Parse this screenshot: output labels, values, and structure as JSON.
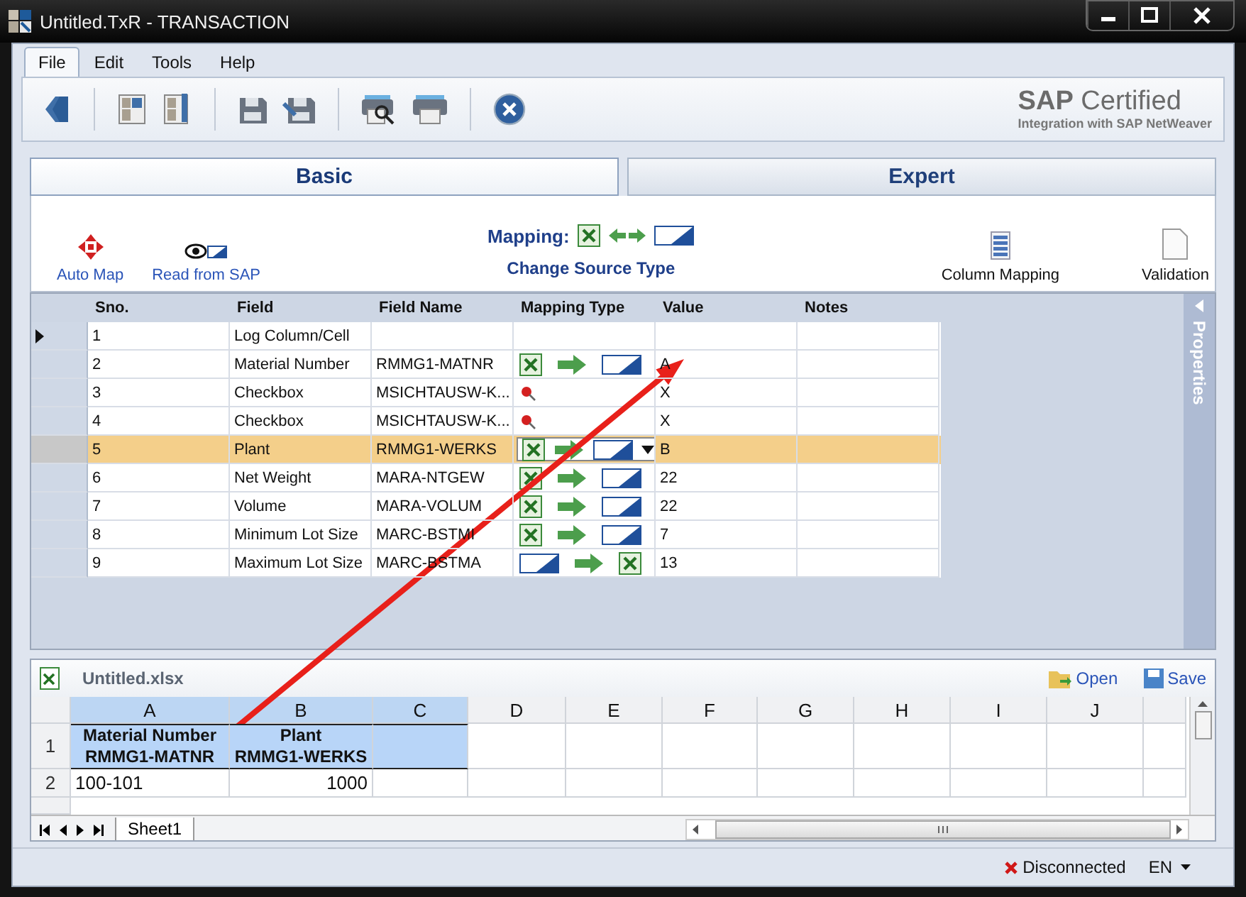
{
  "window": {
    "title": "Untitled.TxR - TRANSACTION"
  },
  "menu": [
    {
      "label": "File",
      "selected": true
    },
    {
      "label": "Edit",
      "selected": false
    },
    {
      "label": "Tools",
      "selected": false
    },
    {
      "label": "Help",
      "selected": false
    }
  ],
  "branding": {
    "title": "**SAP** Certified",
    "subtitle": "Integration with SAP NetWeaver"
  },
  "view_tabs": [
    {
      "label": "Basic",
      "selected": true
    },
    {
      "label": "Expert",
      "selected": false
    }
  ],
  "actions": {
    "auto_map": "Auto Map",
    "read_from_sap": "Read from SAP",
    "mapping_label": "Mapping:",
    "change_source": "Change Source Type",
    "column_mapping": "Column Mapping",
    "validation": "Validation"
  },
  "grid": {
    "columns": [
      "Sno.",
      "Field",
      "Field Name",
      "Mapping Type",
      "Value",
      "Notes"
    ],
    "rows": [
      {
        "sno": "1",
        "description": "Log Column/Cell",
        "kind": "none",
        "current": true,
        "selected": false
      },
      {
        "sno": "2",
        "description": "Material Number",
        "field_name": "RMMG1-MATNR",
        "kind": "excel-to-sap",
        "value": "A",
        "current": false,
        "selected": false
      },
      {
        "sno": "3",
        "description": "Checkbox",
        "field_name": "MSICHTAUSW-K...",
        "kind": "pin",
        "value": "X",
        "current": false,
        "selected": false
      },
      {
        "sno": "4",
        "description": "Checkbox",
        "field_name": "MSICHTAUSW-K...",
        "kind": "pin",
        "value": "X",
        "current": false,
        "selected": false
      },
      {
        "sno": "5",
        "description": "Plant",
        "field_name": "RMMG1-WERKS",
        "kind": "excel-to-sap",
        "value": "B",
        "current": false,
        "selected": true
      },
      {
        "sno": "6",
        "description": "Net Weight",
        "field_name": "MARA-NTGEW",
        "kind": "excel-to-sap",
        "value": "22",
        "current": false,
        "selected": false
      },
      {
        "sno": "7",
        "description": "Volume",
        "field_name": "MARA-VOLUM",
        "kind": "excel-to-sap",
        "value": "22",
        "current": false,
        "selected": false
      },
      {
        "sno": "8",
        "description": "Minimum Lot Size",
        "field_name": "MARC-BSTMI",
        "kind": "excel-to-sap",
        "value": "7",
        "current": false,
        "selected": false
      },
      {
        "sno": "9",
        "description": "Maximum Lot Size",
        "field_name": "MARC-BSTMA",
        "kind": "sap-to-excel",
        "value": "13",
        "current": false,
        "selected": false
      }
    ]
  },
  "side_panel": {
    "title": "Properties"
  },
  "spreadsheet": {
    "file": "Untitled.xlsx",
    "open": "Open",
    "save": "Save",
    "columns": [
      {
        "label": "A",
        "selected": true
      },
      {
        "label": "B",
        "selected": true
      },
      {
        "label": "C",
        "selected": true
      },
      {
        "label": "D",
        "selected": false
      },
      {
        "label": "E",
        "selected": false
      },
      {
        "label": "F",
        "selected": false
      },
      {
        "label": "G",
        "selected": false
      },
      {
        "label": "H",
        "selected": false
      },
      {
        "label": "I",
        "selected": false
      },
      {
        "label": "J",
        "selected": false
      }
    ],
    "rows": [
      {
        "header": "1",
        "cells": [
          {
            "text": "Material Number\nRMMG1-MATNR",
            "selected": true
          },
          {
            "text": "Plant\nRMMG1-WERKS",
            "selected": true
          },
          {
            "selected": true
          },
          {
            "selected": false
          },
          {
            "selected": false
          },
          {
            "selected": false
          },
          {
            "selected": false
          },
          {
            "selected": false
          },
          {
            "selected": false
          },
          {
            "selected": false
          }
        ]
      },
      {
        "header": "2",
        "cells": [
          {
            "text": "100-101",
            "selected": false
          },
          {
            "text": "1000",
            "kind": "number",
            "selected": false
          },
          {
            "selected": false
          },
          {
            "selected": false
          },
          {
            "selected": false
          },
          {
            "selected": false
          },
          {
            "selected": false
          },
          {
            "selected": false
          },
          {
            "selected": false
          },
          {
            "selected": false
          }
        ]
      }
    ],
    "sheet_tabs": [
      {
        "label": "Sheet1",
        "selected": true
      }
    ]
  },
  "status": {
    "connection": "Disconnected",
    "connected": false,
    "language": "EN"
  }
}
